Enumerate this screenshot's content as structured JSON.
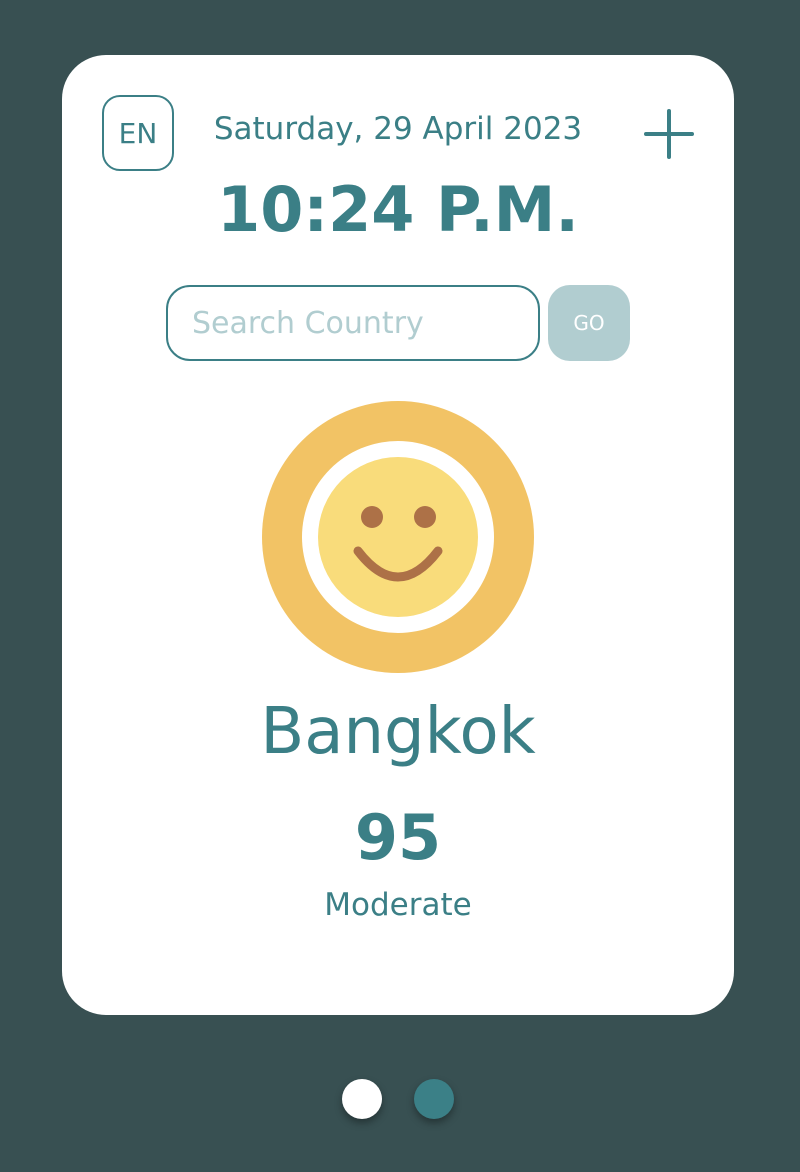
{
  "header": {
    "language": "EN",
    "date": "Saturday, 29 April 2023",
    "time": "10:24 P.M.",
    "add_icon": "plus-icon"
  },
  "search": {
    "placeholder": "Search Country",
    "value": "",
    "go_label": "GO"
  },
  "air_quality": {
    "icon": "smiley-face-icon",
    "city": "Bangkok",
    "aqi": "95",
    "status": "Moderate",
    "colors": {
      "ring": "#f2c365",
      "face": "#f9dc7b",
      "features": "#ad7147"
    }
  },
  "pagination": {
    "pages": 2,
    "active_page": 1
  },
  "theme": {
    "background": "#385052",
    "primary": "#3b7f86",
    "muted": "#b1cdd0"
  }
}
